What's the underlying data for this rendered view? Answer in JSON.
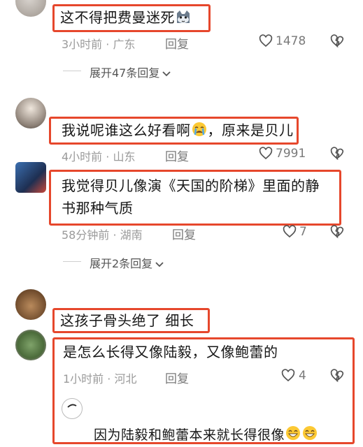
{
  "comments": [
    {
      "text": "这不得把费曼迷死",
      "time": "3小时前",
      "location": "广东",
      "reply_label": "回复",
      "likes": "1478"
    },
    {
      "text_a": "我说呢谁这么好看啊",
      "text_b": "，原来是贝儿",
      "time": "4小时前",
      "location": "山东",
      "reply_label": "回复",
      "likes": "7991"
    },
    {
      "line1": "我觉得贝儿像演《天国的阶梯》里面的静",
      "line2": "书那种气质",
      "time": "58分钟前",
      "location": "湖南",
      "reply_label": "回复",
      "likes": "7"
    },
    {
      "text": "这孩子骨头绝了 细长"
    },
    {
      "text": "是怎么长得又像陆毅，又像鲍蕾的",
      "time": "1小时前",
      "location": "河北",
      "reply_label": "回复",
      "likes": "4"
    }
  ],
  "expanders": [
    {
      "label": "展开47条回复"
    },
    {
      "label": "展开2条回复"
    }
  ],
  "nested_reply": {
    "text": "因为陆毅和鲍蕾本来就长得很像"
  },
  "colors": {
    "highlight": "#e6472c",
    "meta": "#9a9a9a"
  },
  "icons": [
    "cat-emoji-icon",
    "heart-icon",
    "broken-heart-icon",
    "chevron-down-icon",
    "crying-emoji-icon",
    "grin-emoji-icon"
  ]
}
